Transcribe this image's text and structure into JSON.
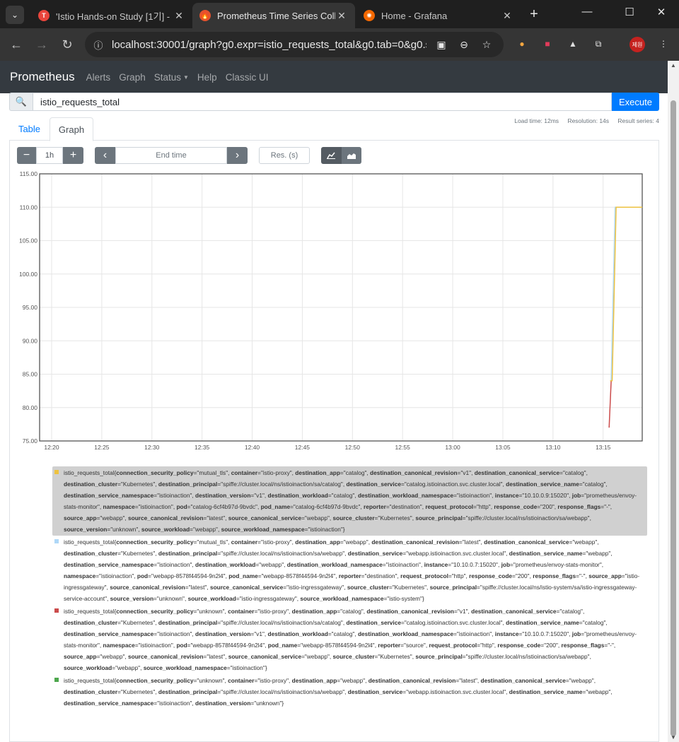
{
  "browser": {
    "tabs": [
      {
        "title": "'Istio Hands-on Study [1기] -",
        "active": false,
        "favicon": "T"
      },
      {
        "title": "Prometheus Time Series Colle",
        "active": true,
        "favicon": "prometheus"
      },
      {
        "title": "Home - Grafana",
        "active": false,
        "favicon": "grafana"
      }
    ],
    "url": "localhost:30001/graph?g0.expr=istio_requests_total&g0.tab=0&g0.st...",
    "profile_label": "제원"
  },
  "prometheus": {
    "brand": "Prometheus",
    "nav": [
      "Alerts",
      "Graph",
      "Status",
      "Help",
      "Classic UI"
    ],
    "query": "istio_requests_total",
    "execute_label": "Execute",
    "tabs": {
      "table": "Table",
      "graph": "Graph"
    },
    "stats": {
      "load_time": "Load time: 12ms",
      "resolution": "Resolution: 14s",
      "result_series": "Result series: 4"
    },
    "controls": {
      "minus": "−",
      "range": "1h",
      "plus": "+",
      "prev": "‹",
      "end_time_placeholder": "End time",
      "next": "›",
      "res_placeholder": "Res. (s)"
    }
  },
  "chart_data": {
    "type": "line",
    "x_ticks": [
      "12:20",
      "12:25",
      "12:30",
      "12:35",
      "12:40",
      "12:45",
      "12:50",
      "12:55",
      "13:00",
      "13:05",
      "13:10",
      "13:15"
    ],
    "y_ticks": [
      "75.00",
      "80.00",
      "85.00",
      "90.00",
      "95.00",
      "100.00",
      "105.00",
      "110.00",
      "115.00"
    ],
    "ylim": [
      75,
      115
    ],
    "xlim_minutes": [
      -1.2,
      58.9
    ],
    "grid": true,
    "series": [
      {
        "color": "#edc240",
        "points": [
          [
            55.7,
            84
          ],
          [
            55.9,
            84
          ],
          [
            56.3,
            110
          ],
          [
            58.9,
            110
          ]
        ]
      },
      {
        "color": "#afd8f8",
        "points": [
          [
            55.8,
            84
          ],
          [
            56.2,
            110
          ],
          [
            58.9,
            110
          ]
        ]
      },
      {
        "color": "#cb4b4b",
        "points": [
          [
            55.6,
            77
          ],
          [
            55.8,
            84
          ]
        ]
      },
      {
        "color": "#4da74d",
        "points": [
          [
            56.3,
            110
          ],
          [
            58.9,
            110
          ]
        ]
      }
    ]
  },
  "legend": [
    {
      "color": "#edc240",
      "highlighted": true,
      "metric": "istio_requests_total",
      "labels": [
        [
          "connection_security_policy",
          "mutual_tls"
        ],
        [
          "container",
          "istio-proxy"
        ],
        [
          "destination_app",
          "catalog"
        ],
        [
          "destination_canonical_revision",
          "v1"
        ],
        [
          "destination_canonical_service",
          "catalog"
        ],
        [
          "destination_cluster",
          "Kubernetes"
        ],
        [
          "destination_principal",
          "spiffe://cluster.local/ns/istioinaction/sa/catalog"
        ],
        [
          "destination_service",
          "catalog.istioinaction.svc.cluster.local"
        ],
        [
          "destination_service_name",
          "catalog"
        ],
        [
          "destination_service_namespace",
          "istioinaction"
        ],
        [
          "destination_version",
          "v1"
        ],
        [
          "destination_workload",
          "catalog"
        ],
        [
          "destination_workload_namespace",
          "istioinaction"
        ],
        [
          "instance",
          "10.10.0.9:15020"
        ],
        [
          "job",
          "prometheus/envoy-stats-monitor"
        ],
        [
          "namespace",
          "istioinaction"
        ],
        [
          "pod",
          "catalog-6cf4b97d-9bvdc"
        ],
        [
          "pod_name",
          "catalog-6cf4b97d-9bvdc"
        ],
        [
          "reporter",
          "destination"
        ],
        [
          "request_protocol",
          "http"
        ],
        [
          "response_code",
          "200"
        ],
        [
          "response_flags",
          "-"
        ],
        [
          "source_app",
          "webapp"
        ],
        [
          "source_canonical_revision",
          "latest"
        ],
        [
          "source_canonical_service",
          "webapp"
        ],
        [
          "source_cluster",
          "Kubernetes"
        ],
        [
          "source_principal",
          "spiffe://cluster.local/ns/istioinaction/sa/webapp"
        ],
        [
          "source_version",
          "unknown"
        ],
        [
          "source_workload",
          "webapp"
        ],
        [
          "source_workload_namespace",
          "istioinaction"
        ]
      ]
    },
    {
      "color": "#afd8f8",
      "highlighted": false,
      "metric": "istio_requests_total",
      "labels": [
        [
          "connection_security_policy",
          "mutual_tls"
        ],
        [
          "container",
          "istio-proxy"
        ],
        [
          "destination_app",
          "webapp"
        ],
        [
          "destination_canonical_revision",
          "latest"
        ],
        [
          "destination_canonical_service",
          "webapp"
        ],
        [
          "destination_cluster",
          "Kubernetes"
        ],
        [
          "destination_principal",
          "spiffe://cluster.local/ns/istioinaction/sa/webapp"
        ],
        [
          "destination_service",
          "webapp.istioinaction.svc.cluster.local"
        ],
        [
          "destination_service_name",
          "webapp"
        ],
        [
          "destination_service_namespace",
          "istioinaction"
        ],
        [
          "destination_workload",
          "webapp"
        ],
        [
          "destination_workload_namespace",
          "istioinaction"
        ],
        [
          "instance",
          "10.10.0.7:15020"
        ],
        [
          "job",
          "prometheus/envoy-stats-monitor"
        ],
        [
          "namespace",
          "istioinaction"
        ],
        [
          "pod",
          "webapp-8578f44594-9n2l4"
        ],
        [
          "pod_name",
          "webapp-8578f44594-9n2l4"
        ],
        [
          "reporter",
          "destination"
        ],
        [
          "request_protocol",
          "http"
        ],
        [
          "response_code",
          "200"
        ],
        [
          "response_flags",
          "-"
        ],
        [
          "source_app",
          "istio-ingressgateway"
        ],
        [
          "source_canonical_revision",
          "latest"
        ],
        [
          "source_canonical_service",
          "istio-ingressgateway"
        ],
        [
          "source_cluster",
          "Kubernetes"
        ],
        [
          "source_principal",
          "spiffe://cluster.local/ns/istio-system/sa/istio-ingressgateway-service-account"
        ],
        [
          "source_version",
          "unknown"
        ],
        [
          "source_workload",
          "istio-ingressgateway"
        ],
        [
          "source_workload_namespace",
          "istio-system"
        ]
      ]
    },
    {
      "color": "#cb4b4b",
      "highlighted": false,
      "metric": "istio_requests_total",
      "labels": [
        [
          "connection_security_policy",
          "unknown"
        ],
        [
          "container",
          "istio-proxy"
        ],
        [
          "destination_app",
          "catalog"
        ],
        [
          "destination_canonical_revision",
          "v1"
        ],
        [
          "destination_canonical_service",
          "catalog"
        ],
        [
          "destination_cluster",
          "Kubernetes"
        ],
        [
          "destination_principal",
          "spiffe://cluster.local/ns/istioinaction/sa/catalog"
        ],
        [
          "destination_service",
          "catalog.istioinaction.svc.cluster.local"
        ],
        [
          "destination_service_name",
          "catalog"
        ],
        [
          "destination_service_namespace",
          "istioinaction"
        ],
        [
          "destination_version",
          "v1"
        ],
        [
          "destination_workload",
          "catalog"
        ],
        [
          "destination_workload_namespace",
          "istioinaction"
        ],
        [
          "instance",
          "10.10.0.7:15020"
        ],
        [
          "job",
          "prometheus/envoy-stats-monitor"
        ],
        [
          "namespace",
          "istioinaction"
        ],
        [
          "pod",
          "webapp-8578f44594-9n2l4"
        ],
        [
          "pod_name",
          "webapp-8578f44594-9n2l4"
        ],
        [
          "reporter",
          "source"
        ],
        [
          "request_protocol",
          "http"
        ],
        [
          "response_code",
          "200"
        ],
        [
          "response_flags",
          "-"
        ],
        [
          "source_app",
          "webapp"
        ],
        [
          "source_canonical_revision",
          "latest"
        ],
        [
          "source_canonical_service",
          "webapp"
        ],
        [
          "source_cluster",
          "Kubernetes"
        ],
        [
          "source_principal",
          "spiffe://cluster.local/ns/istioinaction/sa/webapp"
        ],
        [
          "source_workload",
          "webapp"
        ],
        [
          "source_workload_namespace",
          "istioinaction"
        ]
      ]
    },
    {
      "color": "#4da74d",
      "highlighted": false,
      "metric": "istio_requests_total",
      "labels": [
        [
          "connection_security_policy",
          "unknown"
        ],
        [
          "container",
          "istio-proxy"
        ],
        [
          "destination_app",
          "webapp"
        ],
        [
          "destination_canonical_revision",
          "latest"
        ],
        [
          "destination_canonical_service",
          "webapp"
        ],
        [
          "destination_cluster",
          "Kubernetes"
        ],
        [
          "destination_principal",
          "spiffe://cluster.local/ns/istioinaction/sa/webapp"
        ],
        [
          "destination_service",
          "webapp.istioinaction.svc.cluster.local"
        ],
        [
          "destination_service_name",
          "webapp"
        ],
        [
          "destination_service_namespace",
          "istioinaction"
        ],
        [
          "destination_version",
          "unknown"
        ]
      ]
    }
  ]
}
